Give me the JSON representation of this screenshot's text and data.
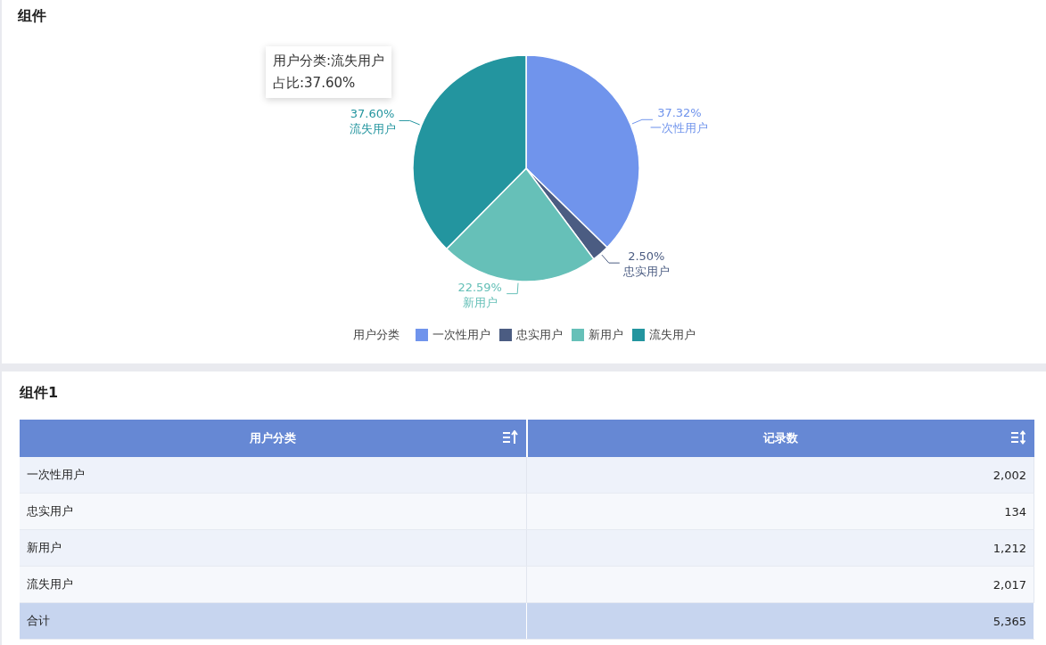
{
  "panels": [
    {
      "title": "组件"
    },
    {
      "title": "组件1"
    }
  ],
  "chart": {
    "chart_data": {
      "type": "pie",
      "categories": [
        "一次性用户",
        "忠实用户",
        "新用户",
        "流失用户"
      ],
      "series": [
        {
          "name": "用户分类",
          "values": [
            37.32,
            2.5,
            22.59,
            37.6
          ]
        }
      ],
      "colors": [
        "#7094ec",
        "#4b5c82",
        "#66c0b8",
        "#23959f"
      ],
      "value_labels": [
        "37.32%",
        "2.50%",
        "22.59%",
        "37.60%"
      ]
    },
    "tooltip": {
      "lines": [
        "用户分类:流失用户",
        "占比:37.60%"
      ]
    }
  },
  "table": {
    "columns": [
      {
        "label": "用户分类",
        "sorted": true
      },
      {
        "label": "记录数",
        "sorted": false
      }
    ],
    "rows": [
      {
        "cells": [
          "一次性用户",
          "2,002"
        ],
        "total": false
      },
      {
        "cells": [
          "忠实用户",
          "134"
        ],
        "total": false
      },
      {
        "cells": [
          "新用户",
          "1,212"
        ],
        "total": false
      },
      {
        "cells": [
          "流失用户",
          "2,017"
        ],
        "total": false
      },
      {
        "cells": [
          "合计",
          "5,365"
        ],
        "total": true
      }
    ]
  }
}
